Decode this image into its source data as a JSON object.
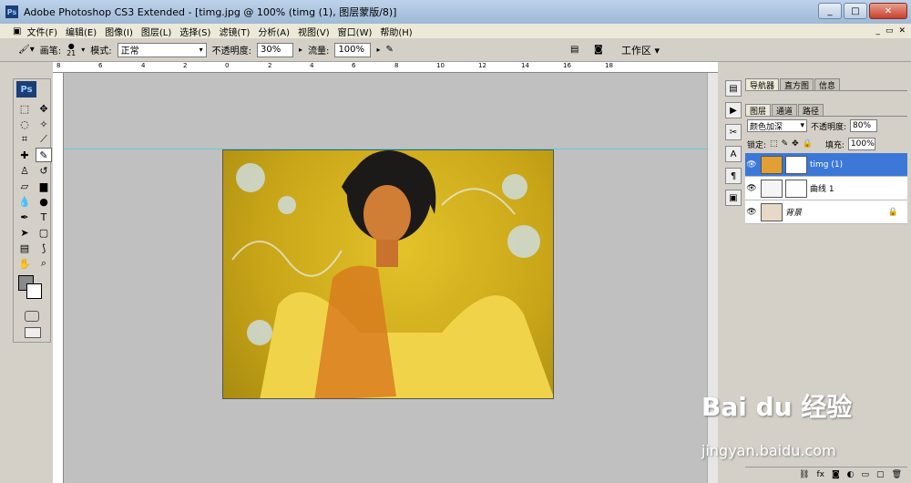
{
  "window": {
    "title": "Adobe Photoshop CS3 Extended - [timg.jpg @ 100% (timg (1), 图层蒙版/8)]"
  },
  "menu": [
    "文件(F)",
    "编辑(E)",
    "图像(I)",
    "图层(L)",
    "选择(S)",
    "滤镜(T)",
    "分析(A)",
    "视图(V)",
    "窗口(W)",
    "帮助(H)"
  ],
  "options": {
    "brush_label": "画笔:",
    "brush_size": "21",
    "mode_label": "模式:",
    "mode_value": "正常",
    "opacity_label": "不透明度:",
    "opacity_value": "30%",
    "flow_label": "流量:",
    "flow_value": "100%",
    "workspace": "工作区"
  },
  "toolbox": {
    "ps_label": "Ps"
  },
  "ruler_top": [
    "8",
    "6",
    "4",
    "2",
    "0",
    "2",
    "4",
    "6",
    "8",
    "10",
    "12",
    "14",
    "16",
    "18"
  ],
  "panel_top": {
    "tabs": [
      "导航器",
      "直方图",
      "信息"
    ]
  },
  "layers_panel": {
    "tabs": [
      "图层",
      "通道",
      "路径"
    ],
    "blend_mode": "颜色加深",
    "opacity_label": "不透明度:",
    "opacity_value": "80%",
    "lock_label": "锁定:",
    "fill_label": "填充:",
    "fill_value": "100%",
    "layers": [
      {
        "name": "timg (1)",
        "selected": true
      },
      {
        "name": "曲线 1",
        "selected": false
      },
      {
        "name": "背景",
        "selected": false
      }
    ]
  },
  "watermark": {
    "text1": "Bai du 经验",
    "text2": "jingyan.baidu.com"
  }
}
